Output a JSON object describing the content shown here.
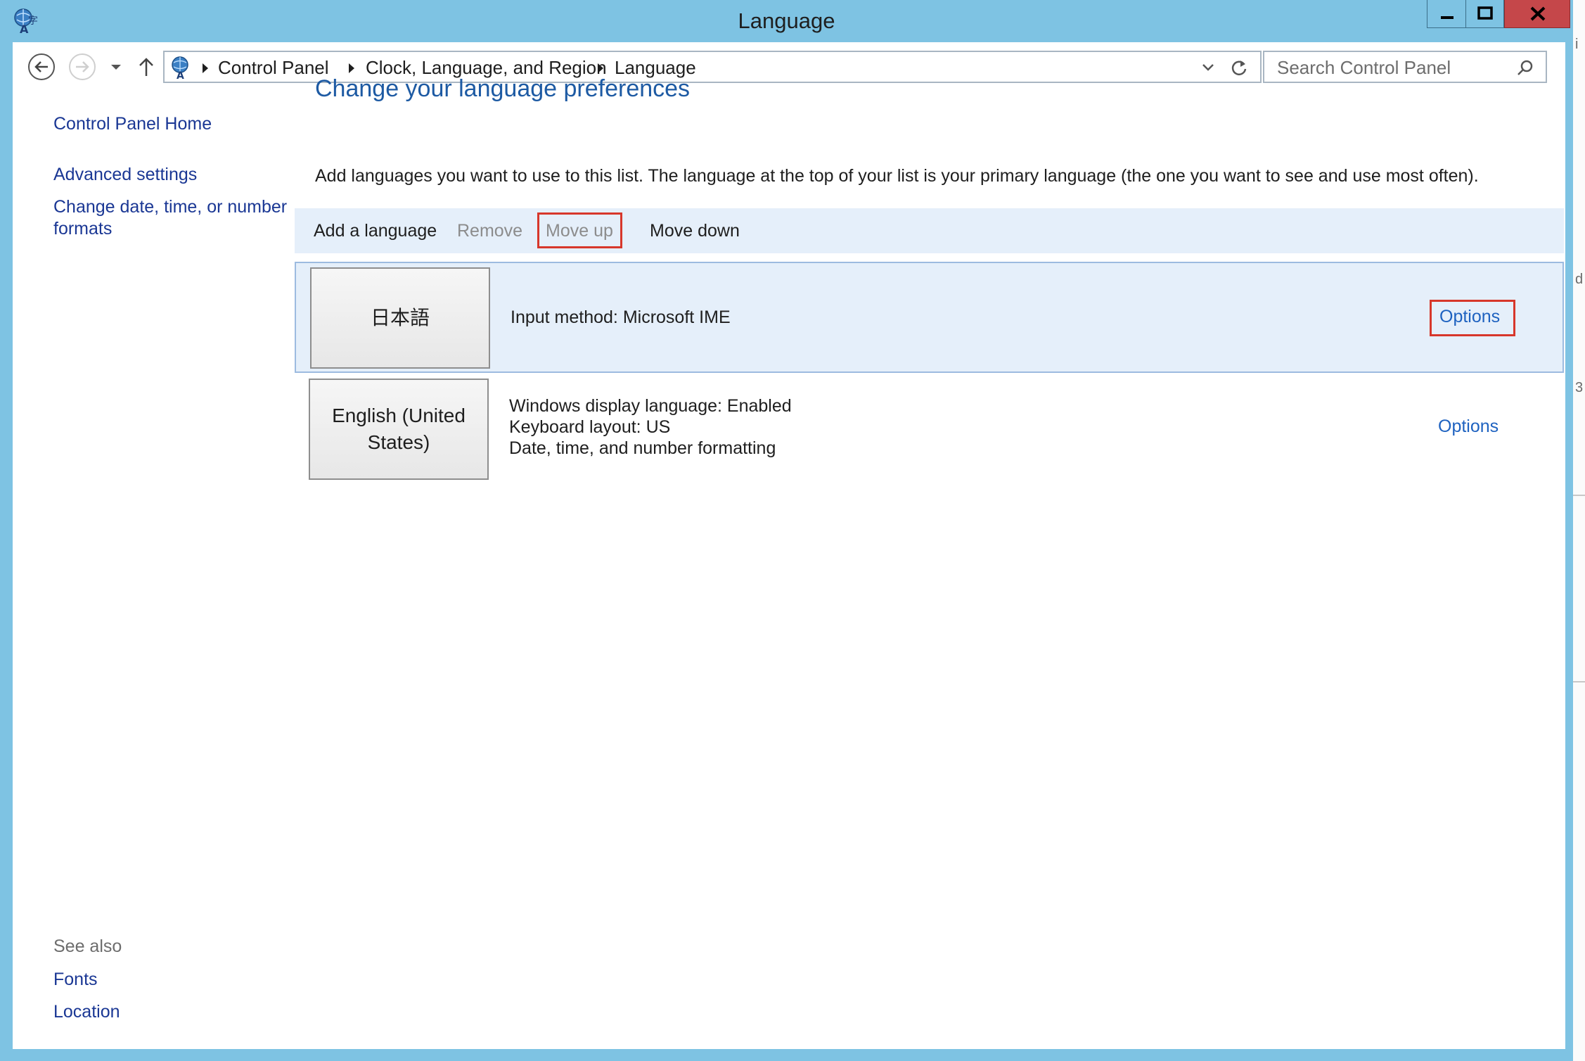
{
  "window": {
    "title": "Language",
    "accent": "#7ec3e3",
    "close_color": "#c5474a"
  },
  "address_bar": {
    "breadcrumb": [
      "Control Panel",
      "Clock, Language, and Region",
      "Language"
    ],
    "search_placeholder": "Search Control Panel"
  },
  "sidebar": {
    "home": "Control Panel Home",
    "links": [
      "Advanced settings",
      "Change date, time, or number formats"
    ],
    "see_also_heading": "See also",
    "see_also": [
      "Fonts",
      "Location"
    ]
  },
  "main": {
    "title": "Change your language preferences",
    "intro": "Add languages you want to use to this list. The language at the top of your list is your primary language (the one you want to see and use most often).",
    "toolbar": {
      "add": "Add a language",
      "remove": "Remove",
      "move_up": "Move up",
      "move_down": "Move down"
    },
    "languages": [
      {
        "tile": "日本語",
        "details": [
          "Input method: Microsoft IME"
        ],
        "options": "Options",
        "selected": true
      },
      {
        "tile": "English (United States)",
        "details": [
          "Windows display language: Enabled",
          "Keyboard layout: US",
          "Date, time, and number formatting"
        ],
        "options": "Options",
        "selected": false
      }
    ]
  },
  "highlight_color": "#d7372b"
}
